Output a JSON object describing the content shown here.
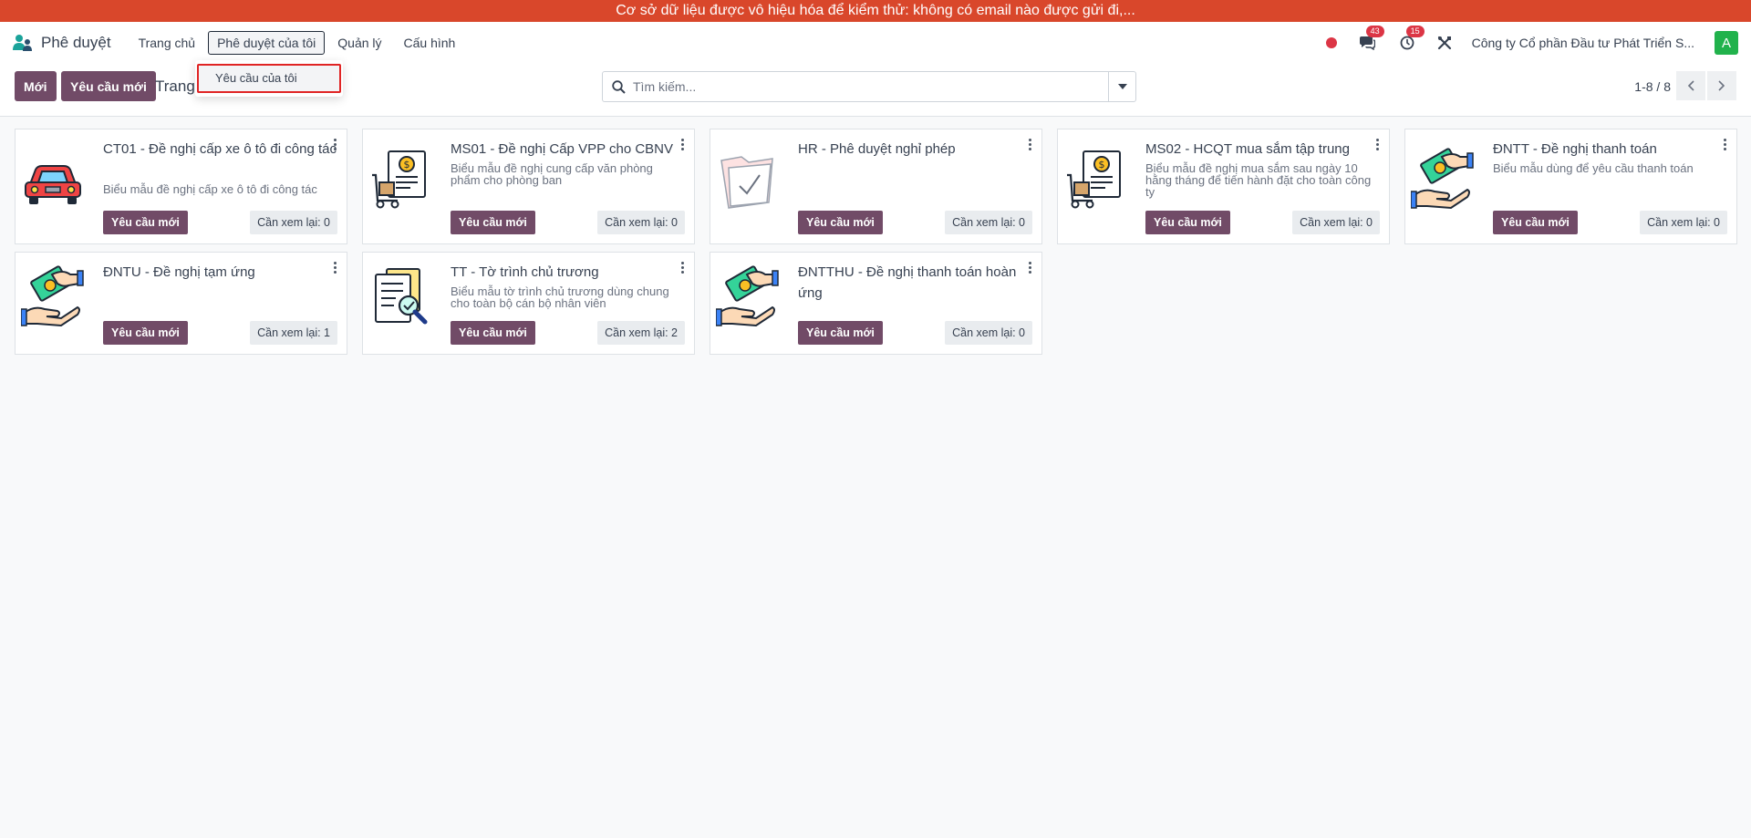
{
  "banner": "Cơ sở dữ liệu được vô hiệu hóa để kiểm thử: không có email nào được gửi đi,...",
  "navbar": {
    "app_name": "Phê duyệt",
    "menus": [
      "Trang chủ",
      "Phê duyệt của tôi",
      "Quản lý",
      "Cấu hình"
    ],
    "messages_count": "43",
    "activities_count": "15",
    "company": "Công ty Cổ phần Đầu tư Phát Triển S...",
    "avatar_initial": "A"
  },
  "dropdown": {
    "items": [
      "Yêu cầu của tôi"
    ]
  },
  "control": {
    "new_label": "Mới",
    "new_request_label": "Yêu cầu mới",
    "breadcrumb": "Trang",
    "search_placeholder": "Tìm kiếm...",
    "pager": "1-8 / 8"
  },
  "cards": [
    {
      "title": "CT01 - Đề nghị cấp xe ô tô đi công tác",
      "desc": "Biểu mẫu đề nghị cấp xe ô tô đi công tác",
      "new_label": "Yêu cầu mới",
      "review_label": "Cần xem lại: 0",
      "icon": "car-icon"
    },
    {
      "title": "MS01 - Đề nghị Cấp VPP cho CBNV",
      "desc": "Biểu mẫu đề nghị cung cấp văn phòng phẩm cho phòng ban",
      "new_label": "Yêu cầu mới",
      "review_label": "Cần xem lại: 0",
      "icon": "purchase-invoice-icon"
    },
    {
      "title": "HR - Phê duyệt nghỉ phép",
      "desc": "",
      "new_label": "Yêu cầu mới",
      "review_label": "Cần xem lại: 0",
      "icon": "folder-check-icon"
    },
    {
      "title": "MS02 - HCQT mua sắm tập trung",
      "desc": "Biểu mẫu đề nghị mua sắm sau ngày 10 hằng tháng để tiến hành đặt cho toàn công ty",
      "new_label": "Yêu cầu mới",
      "review_label": "Cần xem lại: 0",
      "icon": "purchase-invoice-icon"
    },
    {
      "title": "ĐNTT - Đề nghị thanh toán",
      "desc": "Biểu mẫu dùng để yêu cầu thanh toán",
      "new_label": "Yêu cầu mới",
      "review_label": "Cần xem lại: 0",
      "icon": "payment-hand-icon"
    },
    {
      "title": "ĐNTU - Đề nghị tạm ứng",
      "desc": "",
      "new_label": "Yêu cầu mới",
      "review_label": "Cần xem lại: 1",
      "icon": "money-hand-icon"
    },
    {
      "title": "TT - Tờ trình chủ trương",
      "desc": "Biểu mẫu tờ trình chủ trương dùng chung cho toàn bộ cán bộ nhân viên",
      "new_label": "Yêu cầu mới",
      "review_label": "Cần xem lại: 2",
      "icon": "document-search-icon"
    },
    {
      "title": "ĐNTTHU - Đề nghị thanh toán hoàn ứng",
      "desc": "",
      "new_label": "Yêu cầu mới",
      "review_label": "Cần xem lại: 0",
      "icon": "money-hand-icon"
    }
  ]
}
